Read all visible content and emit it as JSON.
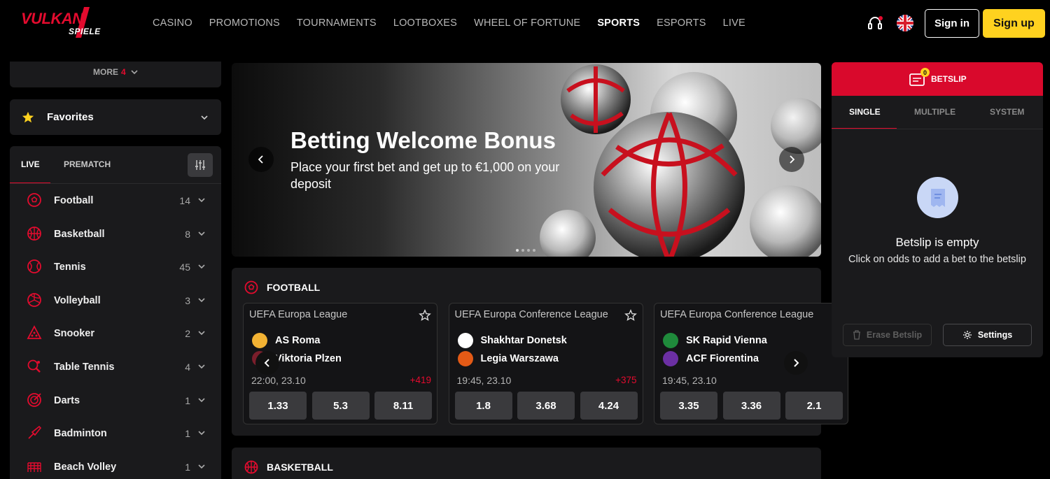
{
  "brand": {
    "logo_main": "VULKAN",
    "logo_sub": "SPIELE"
  },
  "nav": [
    "CASINO",
    "PROMOTIONS",
    "TOURNAMENTS",
    "LOOTBOXES",
    "WHEEL OF FORTUNE",
    "SPORTS",
    "ESPORTS",
    "LIVE"
  ],
  "nav_active": "SPORTS",
  "header": {
    "signin": "Sign in",
    "signup": "Sign up"
  },
  "sidebar": {
    "more_label": "MORE",
    "more_count": "4",
    "favorites": "Favorites",
    "tabs": [
      "LIVE",
      "PREMATCH"
    ],
    "sports": [
      {
        "name": "Football",
        "count": "14",
        "icon": "football-icon"
      },
      {
        "name": "Basketball",
        "count": "8",
        "icon": "basketball-icon"
      },
      {
        "name": "Tennis",
        "count": "45",
        "icon": "tennis-icon"
      },
      {
        "name": "Volleyball",
        "count": "3",
        "icon": "volleyball-icon"
      },
      {
        "name": "Snooker",
        "count": "2",
        "icon": "snooker-icon"
      },
      {
        "name": "Table Tennis",
        "count": "4",
        "icon": "table-tennis-icon"
      },
      {
        "name": "Darts",
        "count": "1",
        "icon": "darts-icon"
      },
      {
        "name": "Badminton",
        "count": "1",
        "icon": "badminton-icon"
      },
      {
        "name": "Beach Volley",
        "count": "1",
        "icon": "beach-volley-icon"
      }
    ]
  },
  "banner": {
    "title": "Betting Welcome Bonus",
    "subtitle": "Place your first bet and get up to €1,000 on your deposit"
  },
  "football": {
    "title": "FOOTBALL",
    "matches": [
      {
        "league": "UEFA Europa League",
        "home": "AS Roma",
        "away": "Viktoria Plzen",
        "time": "22:00, 23.10",
        "more": "+419",
        "odds": [
          "1.33",
          "5.3",
          "8.11"
        ]
      },
      {
        "league": "UEFA Europa Conference League",
        "home": "Shakhtar Donetsk",
        "away": "Legia Warszawa",
        "time": "19:45, 23.10",
        "more": "+375",
        "odds": [
          "1.8",
          "3.68",
          "4.24"
        ]
      },
      {
        "league": "UEFA Europa Conference League",
        "home": "SK Rapid Vienna",
        "away": "ACF Fiorentina",
        "time": "19:45, 23.10",
        "more": "",
        "odds": [
          "3.35",
          "3.36",
          "2.1"
        ]
      }
    ]
  },
  "basketball": {
    "title": "BASKETBALL"
  },
  "betslip": {
    "title": "BETSLIP",
    "count": "0",
    "tabs": [
      "SINGLE",
      "MULTIPLE",
      "SYSTEM"
    ],
    "empty_title": "Betslip is empty",
    "empty_sub": "Click on odds to add a bet to the betslip",
    "erase": "Erase Betslip",
    "settings": "Settings"
  },
  "colors": {
    "accent": "#e30b2e",
    "signup": "#ffd21f",
    "panel": "#1a1a1c"
  }
}
